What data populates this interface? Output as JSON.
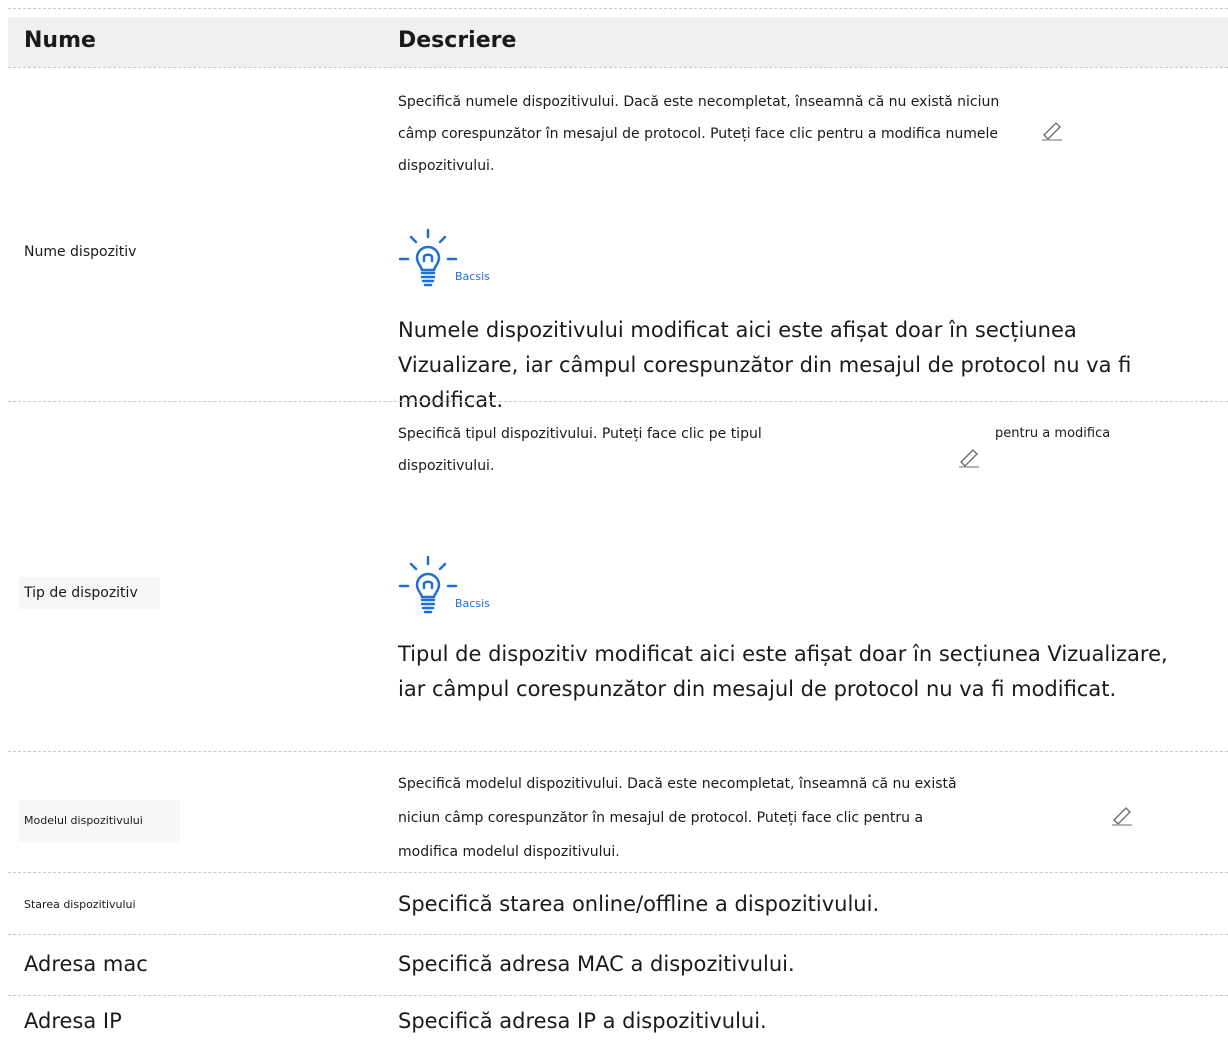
{
  "header": {
    "col_name": "Nume",
    "col_desc": "Descriere"
  },
  "rows": [
    {
      "name": "Nume dispozitiv",
      "desc_lines": [
        "Specifică numele dispozitivului. Dacă este necompletat, înseamnă că nu există niciun",
        "câmp corespunzător în mesajul de protocol. Puteți face clic pentru a modifica numele",
        "dispozitivului."
      ],
      "tip_label": "Bacsis",
      "note_lines": [
        "Numele dispozitivului modificat aici este afișat doar în secțiunea",
        "Vizualizare, iar câmpul corespunzător din mesajul de protocol nu va fi",
        "modificat."
      ]
    },
    {
      "name": "Tip de dispozitiv",
      "desc_line1": "Specifică tipul dispozitivului. Puteți face clic pe tipul",
      "desc_suffix": "pentru a modifica",
      "desc_line2": "dispozitivului.",
      "tip_label": "Bacsis",
      "note_lines": [
        "Tipul de dispozitiv modificat aici este afișat doar în secțiunea Vizualizare,",
        "iar câmpul corespunzător din mesajul de protocol nu va fi modificat."
      ]
    },
    {
      "name": "Modelul dispozitivului",
      "desc_lines": [
        "Specifică modelul dispozitivului. Dacă este necompletat, înseamnă că nu există",
        "niciun câmp corespunzător în mesajul de protocol. Puteți face clic pentru a",
        "modifica modelul dispozitivului."
      ]
    },
    {
      "name": "Starea dispozitivului",
      "desc": "Specifică starea online/offline a dispozitivului."
    },
    {
      "name": "Adresa mac",
      "desc": "Specifică adresa MAC a dispozitivului."
    },
    {
      "name": "Adresa IP",
      "desc": "Specifică adresa IP a dispozitivului."
    }
  ],
  "icons": {
    "tip": "lightbulb-icon",
    "edit": "pencil-icon"
  },
  "colors": {
    "tip_accent": "#1f6fd6",
    "header_bg": "#eef0f2",
    "divider": "#c8c8c8"
  }
}
